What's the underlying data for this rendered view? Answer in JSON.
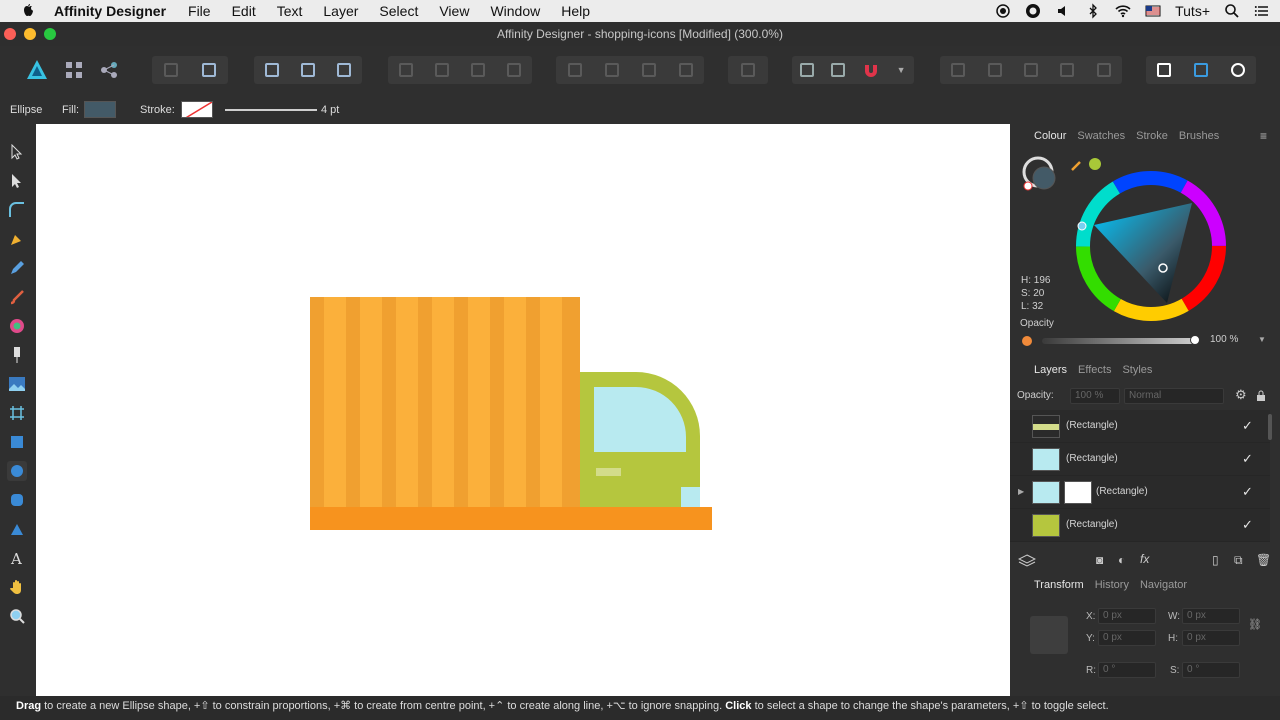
{
  "menubar": {
    "app_name": "Affinity Designer",
    "items": [
      "File",
      "Edit",
      "Text",
      "Layer",
      "Select",
      "View",
      "Window",
      "Help"
    ],
    "user": "Tuts+"
  },
  "window": {
    "title": "Affinity Designer - shopping-icons [Modified] (300.0%)"
  },
  "context_toolbar": {
    "tool_name": "Ellipse",
    "fill_label": "Fill:",
    "stroke_label": "Stroke:",
    "stroke_width": "4 pt",
    "fill_color": "#435a67"
  },
  "colour_panel": {
    "tabs": [
      "Colour",
      "Swatches",
      "Stroke",
      "Brushes"
    ],
    "active_tab": "Colour",
    "h": "H: 196",
    "s": "S: 20",
    "l": "L: 32",
    "opacity_label": "Opacity",
    "opacity_value": "100 %"
  },
  "layers_panel": {
    "tabs": [
      "Layers",
      "Effects",
      "Styles"
    ],
    "opacity_label": "Opacity:",
    "opacity_value": "100 %",
    "blend_mode": "Normal",
    "rows": [
      {
        "name": "(Rectangle)",
        "thumb": "#d3dc8a"
      },
      {
        "name": "(Rectangle)",
        "thumb": "#b8eaf0"
      },
      {
        "name": "(Rectangle)",
        "thumb": "#b8eaf0"
      },
      {
        "name": "(Rectangle)",
        "thumb": "#b5c63e"
      }
    ]
  },
  "transform_panel": {
    "tabs": [
      "Transform",
      "History",
      "Navigator"
    ],
    "x_label": "X:",
    "x_value": "0 px",
    "y_label": "Y:",
    "y_value": "0 px",
    "w_label": "W:",
    "w_value": "0 px",
    "h_label": "H:",
    "h_value": "0 px",
    "r_label": "R:",
    "r_value": "0 °",
    "s_label": "S:",
    "s_value": "0 °"
  },
  "status": {
    "drag": "Drag",
    "drag_text": " to create a new Ellipse shape, +⇧ to constrain proportions, +⌘ to create from centre point, +⌃ to create along line, +⌥ to ignore snapping. ",
    "click": "Click",
    "click_text": " to select a shape to change the shape's parameters, +⇧ to toggle select."
  },
  "colors": {
    "accent": "#2f6db3",
    "truck_cargo": "#fbb03b",
    "truck_stripe": "#f0a030",
    "truck_base": "#f7931e",
    "cab": "#b5c63e",
    "window": "#b8eaf0"
  }
}
